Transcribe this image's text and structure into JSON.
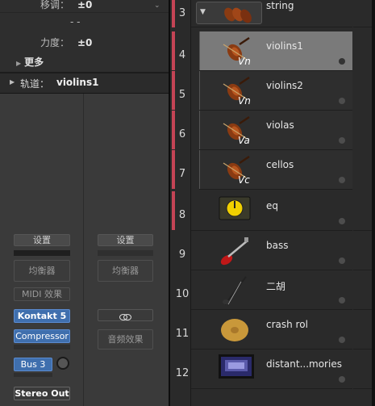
{
  "inspector": {
    "transpose_label": "移调：",
    "transpose_value": "±0",
    "dashes": "- -",
    "velocity_label": "力度：",
    "velocity_value": "±0",
    "more_label": "更多",
    "track_label": "轨道：",
    "track_name": "violins1"
  },
  "strip1": {
    "settings": "设置",
    "eq": "均衡器",
    "midi_fx": "MIDI 效果",
    "instrument": "Kontakt 5",
    "effect": "Compressor",
    "send": "Bus 3",
    "output": "Stereo Out"
  },
  "strip2": {
    "settings": "设置",
    "eq": "均衡器",
    "link_icon": "link-icon",
    "audio_fx": "音频效果"
  },
  "tracks": [
    {
      "num": "3",
      "name": "string",
      "icon": "stacked-strings-icon"
    },
    {
      "num": "4",
      "name": "violins1",
      "icon": "violin-icon",
      "abbr": "Vn"
    },
    {
      "num": "5",
      "name": "violins2",
      "icon": "violin-icon",
      "abbr": "Vn"
    },
    {
      "num": "6",
      "name": "violas",
      "icon": "viola-icon",
      "abbr": "Va"
    },
    {
      "num": "7",
      "name": "cellos",
      "icon": "cello-icon",
      "abbr": "Vc"
    },
    {
      "num": "8",
      "name": "eq",
      "icon": "eq-knob-icon"
    },
    {
      "num": "9",
      "name": "bass",
      "icon": "bass-guitar-icon"
    },
    {
      "num": "10",
      "name": "二胡",
      "icon": "erhu-icon"
    },
    {
      "num": "11",
      "name": "crash rol",
      "icon": "cymbal-icon"
    },
    {
      "num": "12",
      "name": "distant...mories",
      "icon": "screen-thumbnail-icon"
    }
  ],
  "colors": {
    "track_marker": "#c44455",
    "selected_row": "#7a7a7a",
    "plugin_blue": "#3f6fae"
  }
}
